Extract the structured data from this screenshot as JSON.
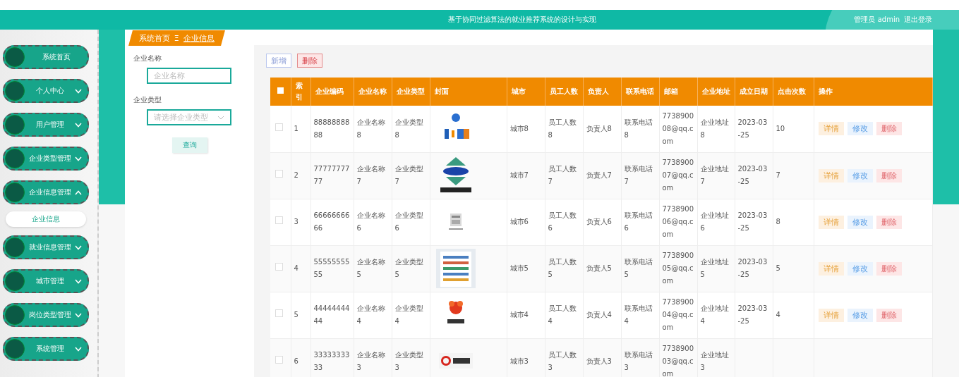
{
  "header": {
    "title": "基于协同过滤算法的就业推荐系统的设计与实现",
    "user": "管理员 admin",
    "logout": "退出登录"
  },
  "sidebar": {
    "items": [
      {
        "label": "系统首页",
        "kind": "link"
      },
      {
        "label": "个人中心",
        "kind": "group",
        "expanded": false
      },
      {
        "label": "用户管理",
        "kind": "group",
        "expanded": false
      },
      {
        "label": "企业类型管理",
        "kind": "group",
        "expanded": false
      },
      {
        "label": "企业信息管理",
        "kind": "group",
        "expanded": true,
        "children": [
          {
            "label": "企业信息",
            "selected": true
          }
        ]
      },
      {
        "label": "就业信息管理",
        "kind": "group",
        "expanded": false
      },
      {
        "label": "城市管理",
        "kind": "group",
        "expanded": false
      },
      {
        "label": "岗位类型管理",
        "kind": "group",
        "expanded": false
      },
      {
        "label": "系统管理",
        "kind": "group",
        "expanded": false
      }
    ]
  },
  "breadcrumb": [
    "系统首页",
    "企业信息"
  ],
  "breadcrumb_separator": "Ξ",
  "search": {
    "fields": [
      {
        "label": "企业名称",
        "kind": "input",
        "placeholder": "企业名称"
      },
      {
        "label": "企业类型",
        "kind": "select",
        "placeholder": "请选择企业类型"
      }
    ],
    "button": "查询"
  },
  "toolbar": {
    "add": "新增",
    "delete": "删除"
  },
  "table": {
    "columns": [
      "索引",
      "企业编码",
      "企业名称",
      "企业类型",
      "封面",
      "城市",
      "员工人数",
      "负责人",
      "联系电话",
      "邮箱",
      "企业地址",
      "成立日期",
      "点击次数",
      "操作"
    ],
    "header_checked": false,
    "rows": [
      {
        "checked": false,
        "index": "1",
        "code": "8888888888",
        "name": "企业名称8",
        "type": "企业类型8",
        "cover": {
          "kind": "picture"
        },
        "city": "城市8",
        "staff": "员工人数8",
        "manager": "负责人8",
        "phone": "联系电话8",
        "email": "773890008@qq.com",
        "address": "企业地址8",
        "date": "2023-03-25",
        "clicks": "10",
        "actions": [
          "详情",
          "修改",
          "删除"
        ]
      },
      {
        "checked": false,
        "index": "2",
        "code": "7777777777",
        "name": "企业名称7",
        "type": "企业类型7",
        "cover": {
          "kind": "picture"
        },
        "city": "城市7",
        "staff": "员工人数7",
        "manager": "负责人7",
        "phone": "联系电话7",
        "email": "773890007@qq.com",
        "address": "企业地址7",
        "date": "2023-03-25",
        "clicks": "7",
        "actions": [
          "详情",
          "修改",
          "删除"
        ]
      },
      {
        "checked": false,
        "index": "3",
        "code": "6666666666",
        "name": "企业名称6",
        "type": "企业类型6",
        "cover": {
          "kind": "picture"
        },
        "city": "城市6",
        "staff": "员工人数6",
        "manager": "负责人6",
        "phone": "联系电话6",
        "email": "773890006@qq.com",
        "address": "企业地址6",
        "date": "2023-03-25",
        "clicks": "8",
        "actions": [
          "详情",
          "修改",
          "删除"
        ]
      },
      {
        "checked": false,
        "index": "4",
        "code": "5555555555",
        "name": "企业名称5",
        "type": "企业类型5",
        "cover": {
          "kind": "picture"
        },
        "city": "城市5",
        "staff": "员工人数5",
        "manager": "负责人5",
        "phone": "联系电话5",
        "email": "773890005@qq.com",
        "address": "企业地址5",
        "date": "2023-03-25",
        "clicks": "5",
        "actions": [
          "详情",
          "修改",
          "删除"
        ]
      },
      {
        "checked": false,
        "index": "5",
        "code": "4444444444",
        "name": "企业名称4",
        "type": "企业类型4",
        "cover": {
          "kind": "picture"
        },
        "city": "城市4",
        "staff": "员工人数4",
        "manager": "负责人4",
        "phone": "联系电话4",
        "email": "773890004@qq.com",
        "address": "企业地址4",
        "date": "2023-03-25",
        "clicks": "4",
        "actions": [
          "详情",
          "修改",
          "删除"
        ]
      },
      {
        "checked": false,
        "index": "6",
        "code": "3333333333",
        "name": "企业名称3",
        "type": "企业类型3",
        "cover": {
          "kind": "picture"
        },
        "city": "城市3",
        "staff": "员工人数3",
        "manager": "负责人3",
        "phone": "联系电话3",
        "email": "773890003@qq.com",
        "address": "企业地址3",
        "actions": []
      }
    ]
  }
}
